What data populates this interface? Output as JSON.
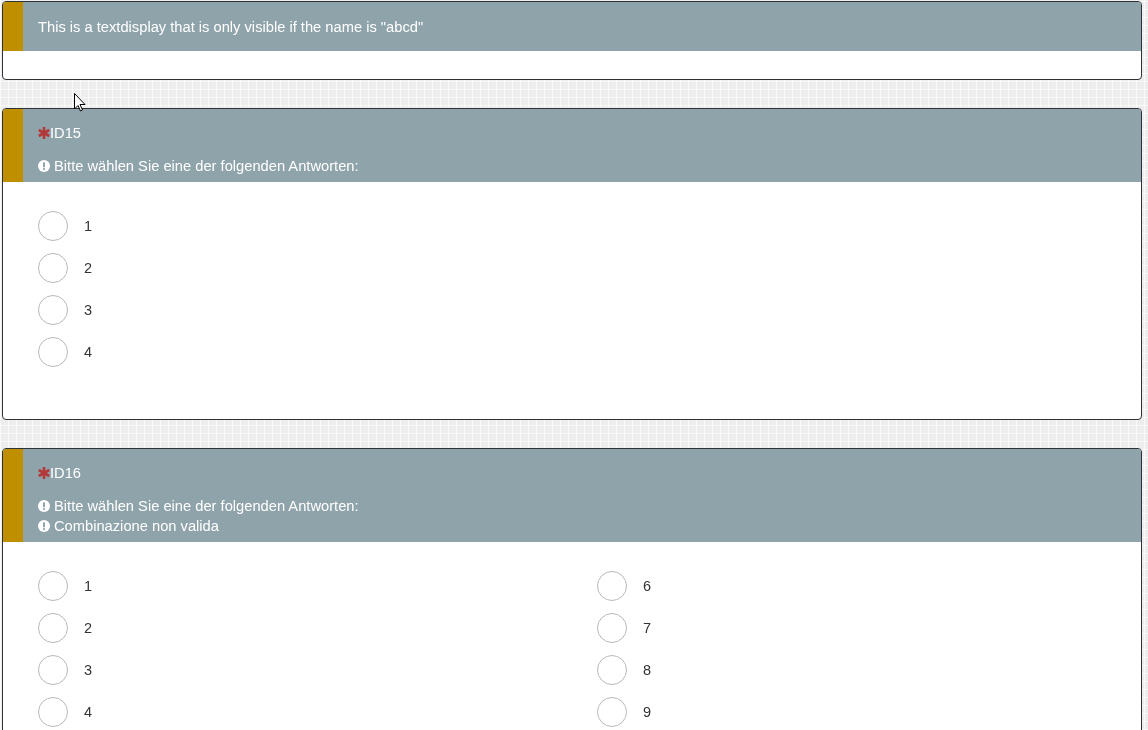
{
  "questions": [
    {
      "kind": "text",
      "text": "This is a textdisplay that is only visible if the name is \"abcd\""
    },
    {
      "kind": "radio",
      "required": true,
      "title": "ID15",
      "messages": [
        "Bitte wählen Sie eine der folgenden Antworten:"
      ],
      "columns": [
        [
          {
            "label": "1",
            "selected": false
          },
          {
            "label": "2",
            "selected": false
          },
          {
            "label": "3",
            "selected": false
          },
          {
            "label": "4",
            "selected": false
          }
        ]
      ]
    },
    {
      "kind": "radio",
      "required": true,
      "title": "ID16",
      "messages": [
        "Bitte wählen Sie eine der folgenden Antworten:",
        "Combinazione non valida"
      ],
      "columns": [
        [
          {
            "label": "1",
            "selected": false
          },
          {
            "label": "2",
            "selected": false
          },
          {
            "label": "3",
            "selected": false
          },
          {
            "label": "4",
            "selected": false
          }
        ],
        [
          {
            "label": "6",
            "selected": false
          },
          {
            "label": "7",
            "selected": false
          },
          {
            "label": "8",
            "selected": false
          },
          {
            "label": "9",
            "selected": false
          }
        ]
      ]
    }
  ]
}
